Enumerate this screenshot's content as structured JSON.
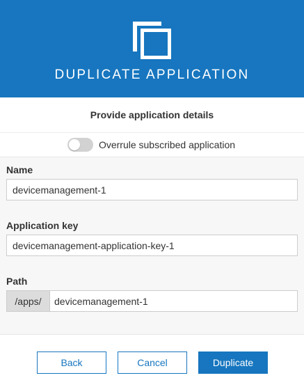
{
  "header": {
    "icon": "duplicate-icon",
    "title": "DUPLICATE APPLICATION"
  },
  "subtitle": "Provide application details",
  "toggle": {
    "label": "Overrule subscribed application",
    "checked": false
  },
  "form": {
    "name": {
      "label": "Name",
      "value": "devicemanagement-1"
    },
    "key": {
      "label": "Application key",
      "value": "devicemanagement-application-key-1"
    },
    "path": {
      "label": "Path",
      "prefix": "/apps/",
      "value": "devicemanagement-1"
    }
  },
  "buttons": {
    "back": "Back",
    "cancel": "Cancel",
    "duplicate": "Duplicate"
  },
  "colors": {
    "accent": "#1776bf",
    "form_background": "#f7f7f7"
  }
}
